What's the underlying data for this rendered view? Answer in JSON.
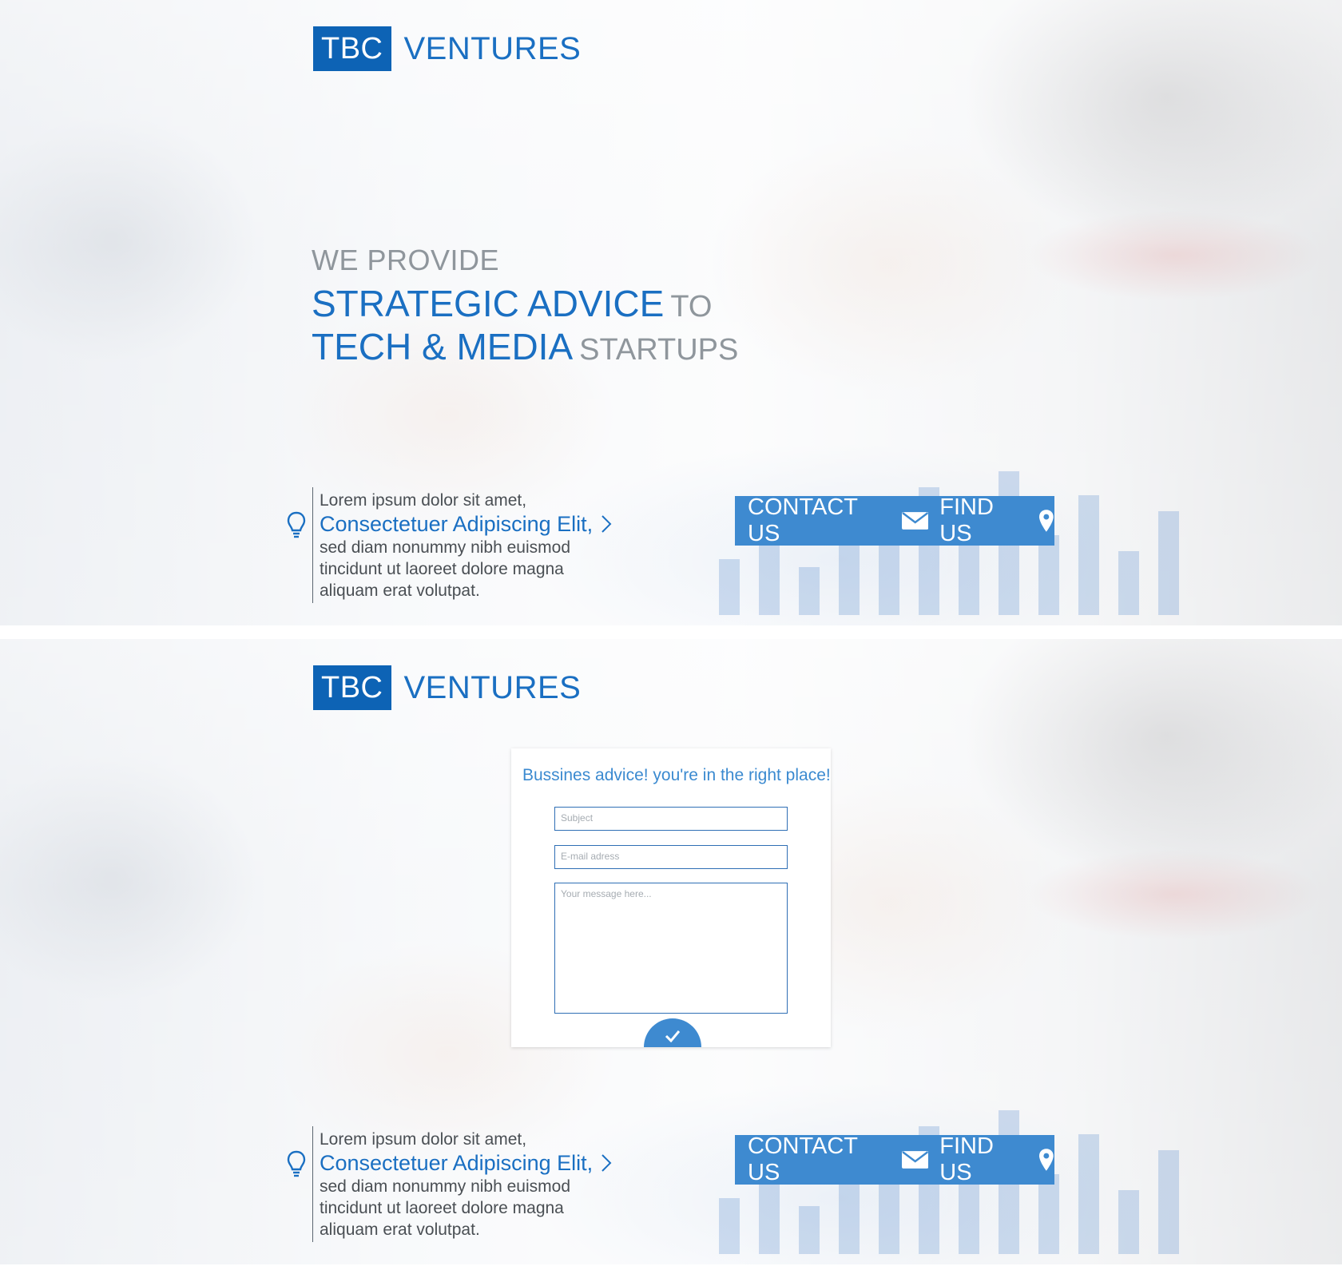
{
  "colors": {
    "brand_blue": "#0d63b5",
    "accent_blue": "#1a6fc2",
    "button_blue": "#3e8ad0",
    "muted_gray": "#8f969c"
  },
  "top": {
    "brand": {
      "box": "TBC",
      "word": "VENTURES"
    },
    "headline": {
      "line1": "WE PROVIDE",
      "line2_bold": "STRATEGIC ADVICE",
      "line2_light": "TO",
      "line3_bold": "TECH & MEDIA",
      "line3_light": "STARTUPS"
    },
    "info": {
      "icon": "lightbulb-icon",
      "line1": "Lorem ipsum dolor sit amet,",
      "accent": "Consectetuer Adipiscing Elit,",
      "line3": "sed diam nonummy nibh euismod",
      "line4": "tincidunt ut laoreet dolore magna",
      "line5": "aliquam erat volutpat."
    },
    "actions": {
      "contact_label": "CONTACT US",
      "contact_icon": "envelope-icon",
      "find_label": "FIND US",
      "find_icon": "map-pin-icon"
    }
  },
  "bottom": {
    "brand": {
      "box": "TBC",
      "word": "VENTURES"
    },
    "form": {
      "title": "Bussines advice! you're in the right place!",
      "subject_placeholder": "Subject",
      "email_placeholder": "E-mail adress",
      "message_placeholder": "Your message here...",
      "submit_icon": "checkmark-icon"
    },
    "info": {
      "icon": "lightbulb-icon",
      "line1": "Lorem ipsum dolor sit amet,",
      "accent": "Consectetuer Adipiscing Elit,",
      "line3": "sed diam nonummy nibh euismod",
      "line4": "tincidunt ut laoreet dolore magna",
      "line5": "aliquam erat volutpat."
    },
    "actions": {
      "contact_label": "CONTACT US",
      "contact_icon": "envelope-icon",
      "find_label": "FIND US",
      "find_icon": "map-pin-icon"
    }
  }
}
